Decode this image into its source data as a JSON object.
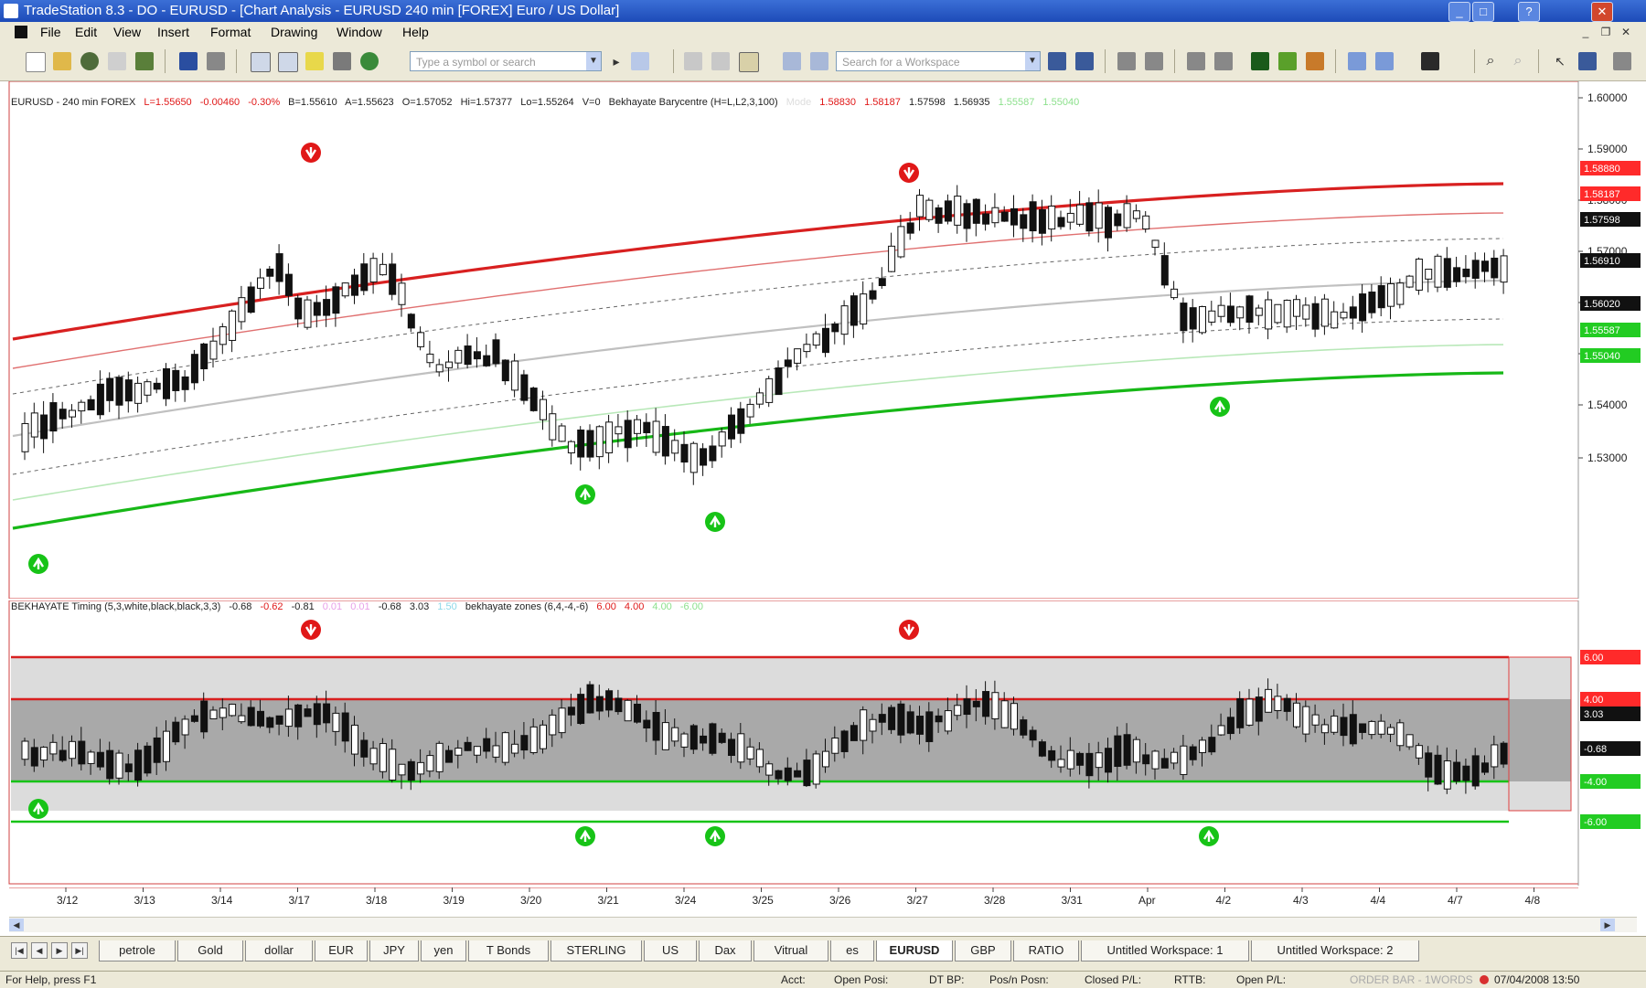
{
  "window": {
    "title": "TradeStation 8.3 - DO - EURUSD - [Chart Analysis - EURUSD 240 min [FOREX] Euro / US Dollar]"
  },
  "menu": [
    "File",
    "Edit",
    "View",
    "Insert",
    "Format",
    "Drawing",
    "Window",
    "Help"
  ],
  "toolbar": {
    "symbol_placeholder": "Type a symbol or search",
    "search_placeholder": "Search for a Workspace"
  },
  "legend_main": {
    "symbol": "EURUSD - 240 min  FOREX",
    "last": "L=1.55650",
    "change": "-0.00460",
    "pct": "-0.30%",
    "bid": "B=1.55610",
    "ask": "A=1.55623",
    "open": "O=1.57052",
    "high": "Hi=1.57377",
    "low": "Lo=1.55264",
    "vol": "V=0",
    "study": "Bekhayate Barycentre (H=L,L2,3,100)",
    "study_name": "Mode",
    "study_values": [
      "1.58830",
      "1.58187",
      "1.57598",
      "1.56935",
      "1.55587",
      "1.55040"
    ]
  },
  "legend_sub": {
    "study": "BEKHAYATE Timing (5,3,white,black,black,3,3)",
    "values": [
      "-0.68",
      "-0.62",
      "-0.81",
      "0.01",
      "0.01",
      "-0.68",
      "3.03",
      "1.50"
    ],
    "zones_name": "bekhayate zones (6,4,-4,-6)",
    "zones_values": [
      "6.00",
      "4.00",
      "4.00",
      "-6.00"
    ]
  },
  "price_axis": {
    "ticks": [
      "1.60000",
      "1.59000",
      "1.58000",
      "1.57000",
      "1.56000",
      "1.55000",
      "1.54000",
      "1.53000"
    ],
    "markers": [
      {
        "label": "1.58880",
        "color": "#ff2a2a"
      },
      {
        "label": "1.58187",
        "color": "#ff2a2a"
      },
      {
        "label": "1.57598",
        "color": "#111111"
      },
      {
        "label": "1.56910",
        "color": "#111111"
      },
      {
        "label": "1.56020",
        "color": "#111111"
      },
      {
        "label": "1.55587",
        "color": "#22cc22"
      },
      {
        "label": "1.55040",
        "color": "#22cc22"
      }
    ]
  },
  "osc_axis": {
    "markers": [
      {
        "label": "6.00",
        "color": "#ff2a2a"
      },
      {
        "label": "4.00",
        "color": "#ff2a2a"
      },
      {
        "label": "3.03",
        "color": "#111111"
      },
      {
        "label": "-0.68",
        "color": "#111111"
      },
      {
        "label": "-4.00",
        "color": "#22cc22"
      },
      {
        "label": "-6.00",
        "color": "#22cc22"
      }
    ]
  },
  "date_axis": [
    "3/12",
    "3/13",
    "3/14",
    "3/17",
    "3/18",
    "3/19",
    "3/20",
    "3/21",
    "3/24",
    "3/25",
    "3/26",
    "3/27",
    "3/28",
    "3/31",
    "Apr",
    "4/2",
    "4/3",
    "4/4",
    "4/7",
    "4/8"
  ],
  "tabs": [
    "petrole",
    "Gold",
    "dollar",
    "EUR",
    "JPY",
    "yen",
    "T Bonds",
    "STERLING",
    "US",
    "Dax",
    "Vitrual",
    "es",
    "EURUSD",
    "GBP",
    "RATIO",
    "Untitled Workspace: 1",
    "Untitled Workspace: 2"
  ],
  "active_tab": "EURUSD",
  "status": {
    "help": "For Help, press F1",
    "acct": "Acct:",
    "open_pos": "Open Posi:",
    "dt_bp": "DT BP:",
    "pos_pos": "Pos/n Posn:",
    "closed_pl": "Closed P/L:",
    "rttb": "RTTB:",
    "open_pl": "Open P/L:",
    "order_bar": "ORDER BAR - 1WORDS",
    "datetime": "07/04/2008 13:50"
  },
  "colors": {
    "resistance": "#e01818",
    "support": "#17c317",
    "barycentre": "#bdbdbd",
    "zone_inner": "#a8a8a8",
    "zone_outer": "#dadada"
  }
}
